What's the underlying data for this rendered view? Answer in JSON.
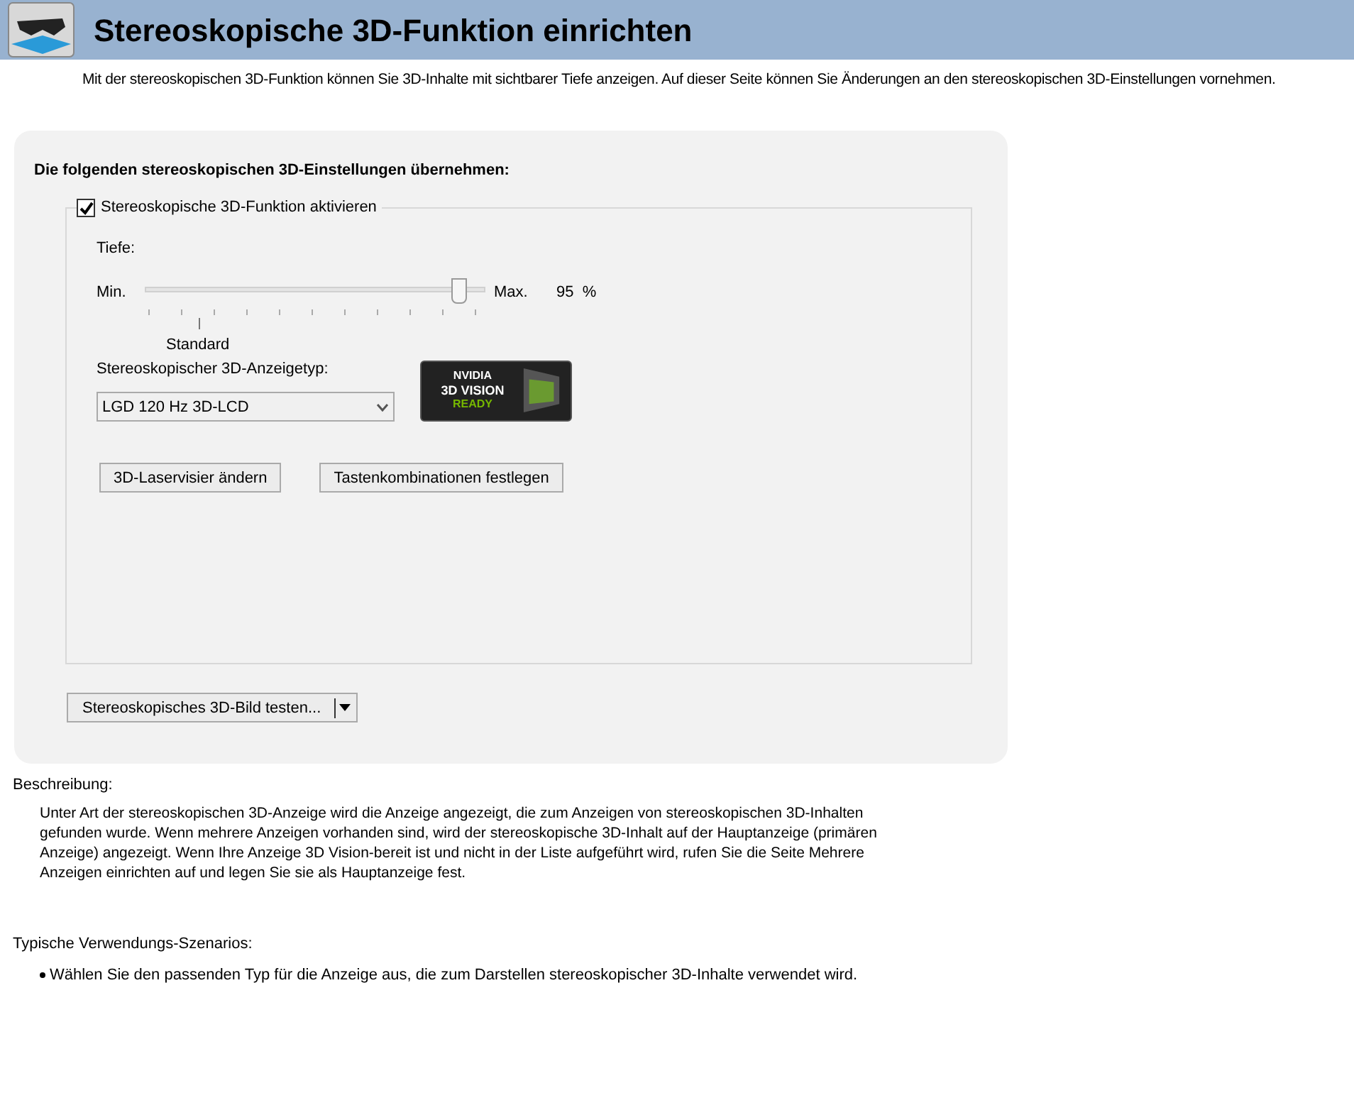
{
  "header": {
    "title": "Stereoskopische 3D-Funktion einrichten"
  },
  "intro": "Mit der stereoskopischen 3D-Funktion können Sie 3D-Inhalte mit sichtbarer Tiefe anzeigen. Auf dieser Seite können Sie Änderungen an den stereoskopischen 3D-Einstellungen vornehmen.",
  "panel": {
    "heading": "Die folgenden stereoskopischen 3D-Einstellungen übernehmen:",
    "enable": {
      "label": "Stereoskopische 3D-Funktion aktivieren",
      "checked": true
    },
    "depth": {
      "label": "Tiefe:",
      "min_label": "Min.",
      "max_label": "Max.",
      "level": 0.93,
      "reading": "95  %",
      "default_label": "Standard"
    },
    "display_type": {
      "label": "Stereoskopischer 3D-Anzeigetyp:",
      "value": "LGD 120 Hz 3D-LCD"
    },
    "logo": {
      "brand": "NVIDIA",
      "line1": "3D VISION",
      "line2": "READY"
    },
    "buttons": [
      "3D-Laservisier ändern",
      "Tastenkombinationen festlegen"
    ],
    "test_button": "Stereoskopisches 3D-Bild testen..."
  },
  "description": {
    "label": "Beschreibung:",
    "text": "Unter Art der stereoskopischen 3D-Anzeige wird die Anzeige angezeigt, die zum Anzeigen von stereoskopischen 3D-Inhalten gefunden wurde. Wenn mehrere Anzeigen vorhanden sind, wird der stereoskopische 3D-Inhalt auf der Hauptanzeige (primären Anzeige) angezeigt. Wenn Ihre Anzeige 3D Vision-bereit ist und nicht in der Liste aufgeführt wird, rufen Sie die Seite Mehrere Anzeigen einrichten auf und legen Sie sie als Hauptanzeige fest."
  },
  "scenarios": {
    "label": "Typische Verwendungs-Szenarios:",
    "items": [
      "Wählen Sie den passenden Typ für die Anzeige aus, die zum Darstellen stereoskopischer 3D-Inhalte verwendet wird."
    ]
  }
}
